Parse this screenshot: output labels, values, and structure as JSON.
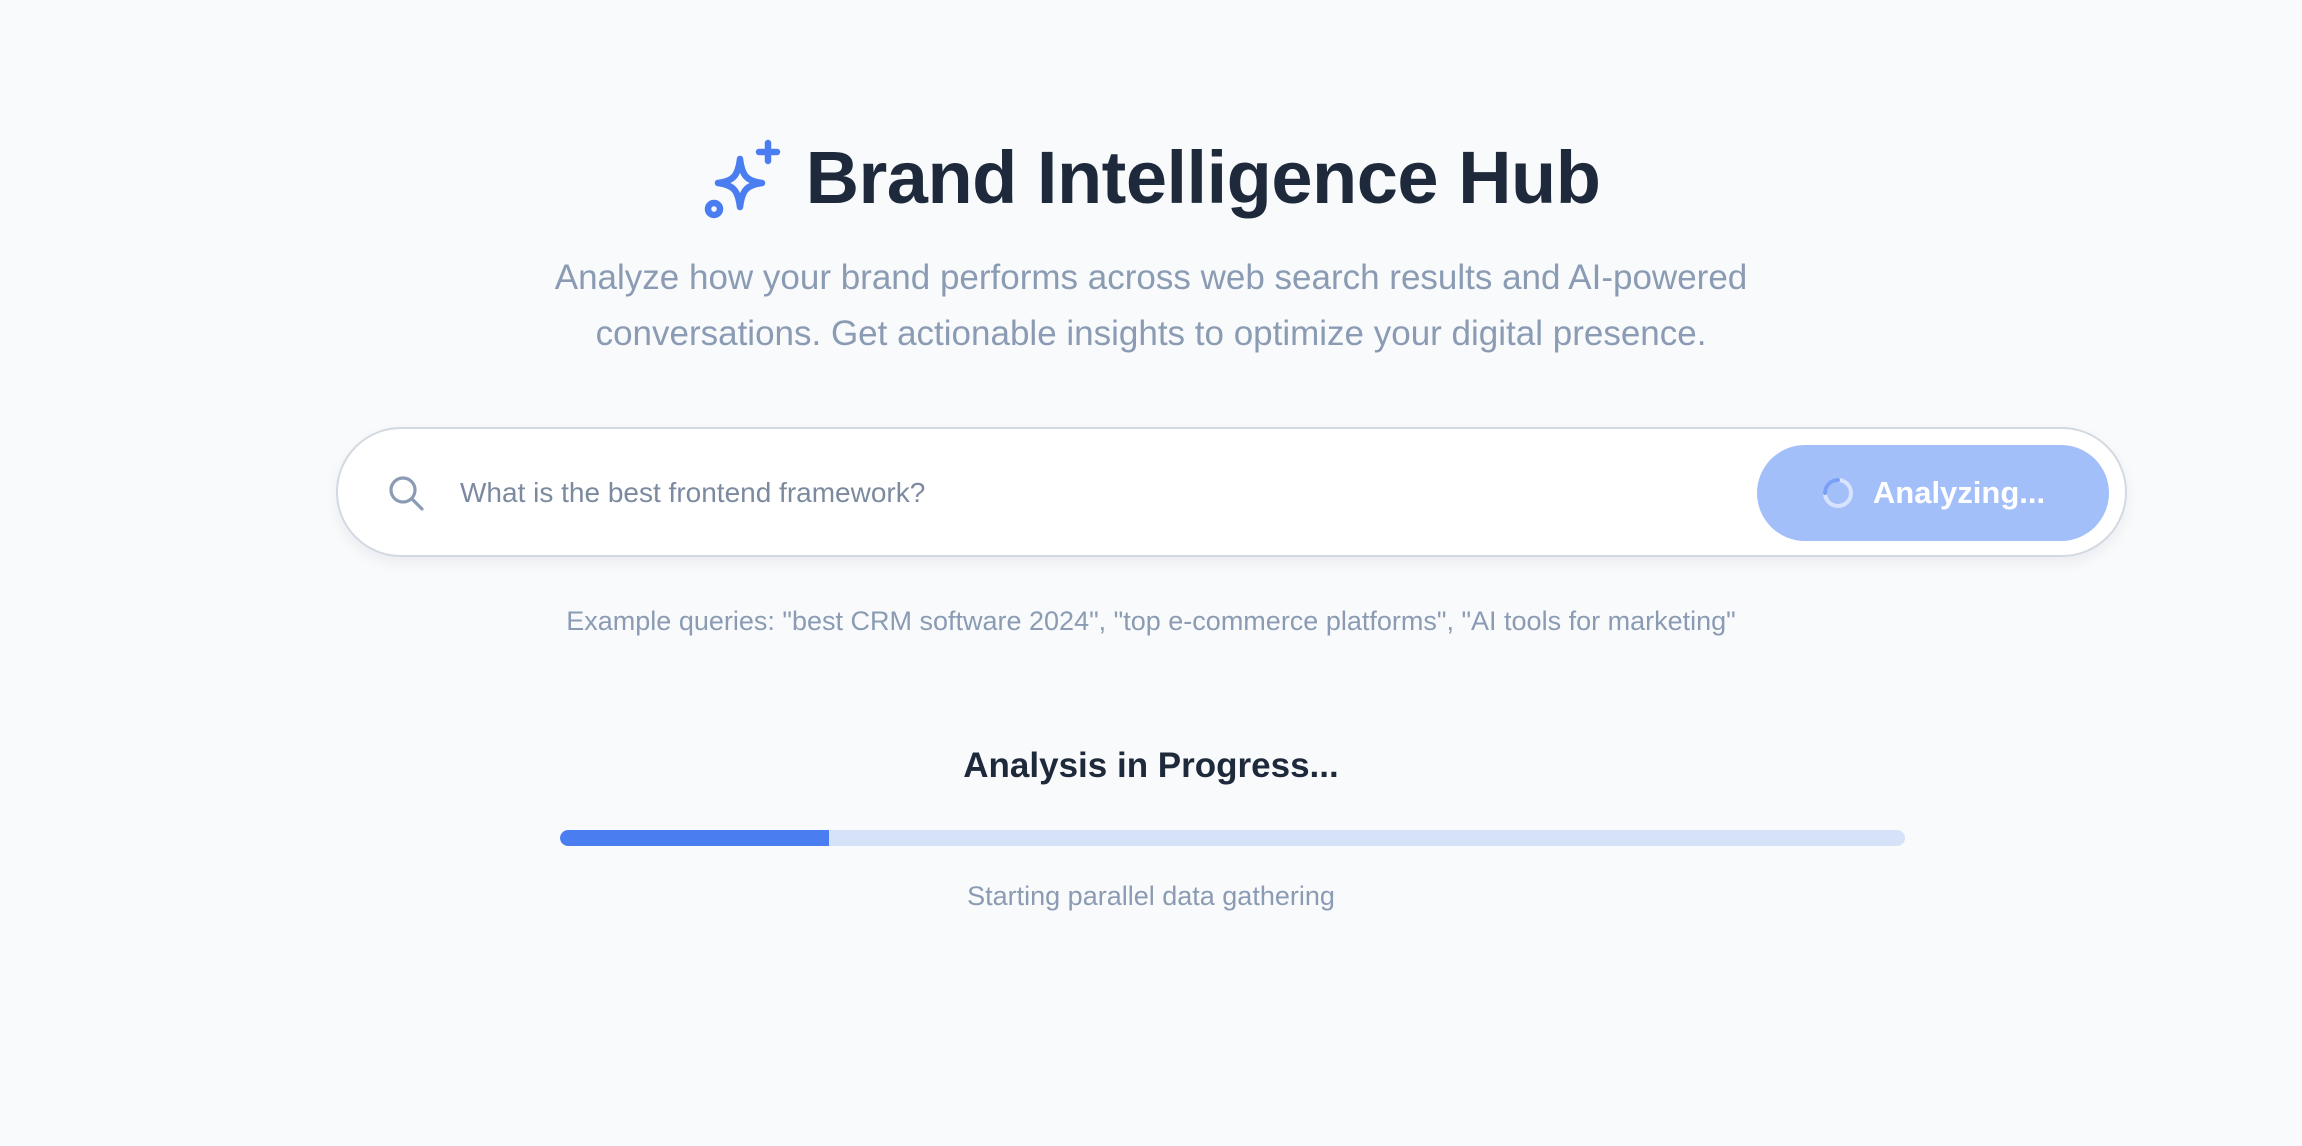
{
  "header": {
    "title": "Brand Intelligence Hub",
    "icon": "sparkles-icon",
    "subtitle": "Analyze how your brand performs across web search results and AI-powered conversations. Get actionable insights to optimize your digital presence."
  },
  "search": {
    "icon": "search-icon",
    "placeholder": "What is the best frontend framework?",
    "value": "",
    "button_label": "Analyzing...",
    "button_icon": "spinner-icon",
    "button_state": "loading"
  },
  "examples": {
    "text": "Example queries: \"best CRM software 2024\", \"top e-commerce platforms\", \"AI tools for marketing\""
  },
  "progress": {
    "title": "Analysis in Progress...",
    "fraction": 0.2,
    "status": "Starting parallel data gathering"
  },
  "colors": {
    "accent": "#4a7ef0",
    "button_disabled": "#a3bffa",
    "title_text": "#1e293b",
    "muted_text": "#8a9bb3",
    "background": "#f8fafc",
    "progress_track": "#d6e2f8"
  }
}
